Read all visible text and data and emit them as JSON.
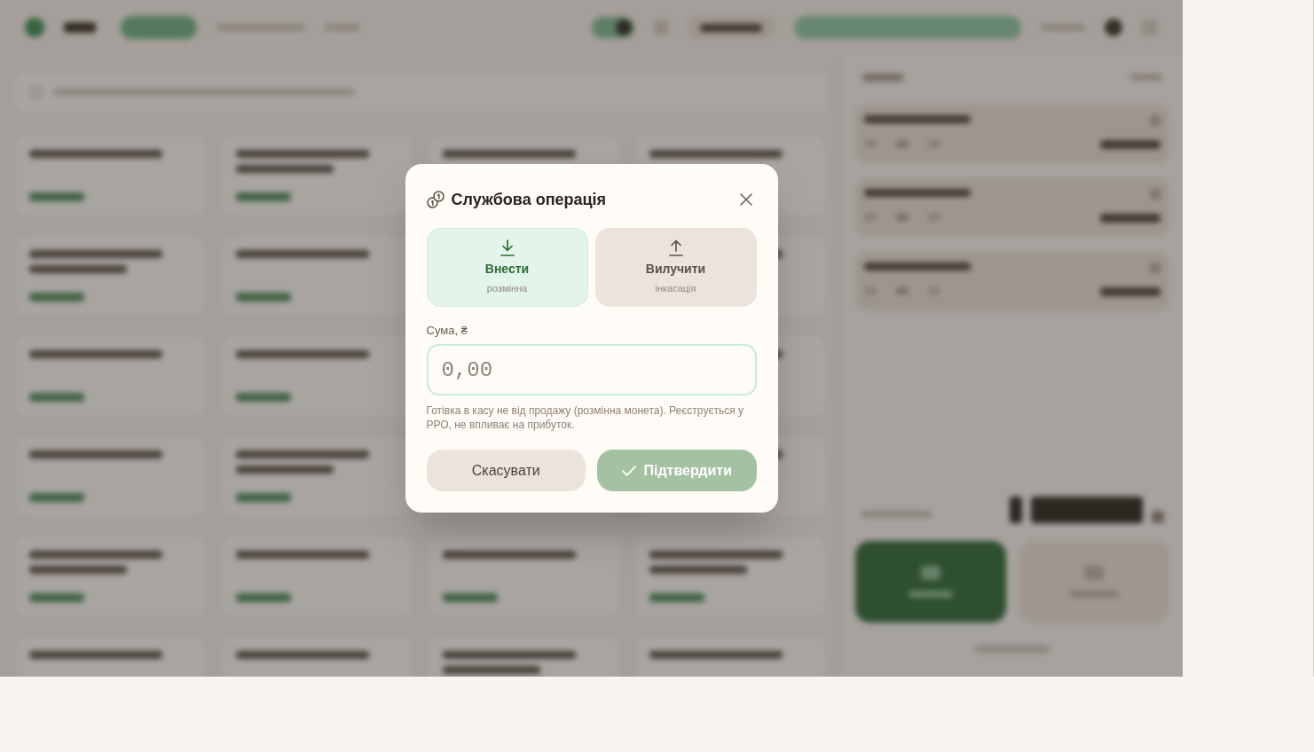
{
  "dialog": {
    "title": "Службова операція",
    "options": [
      {
        "kind": "deposit",
        "label": "Внести",
        "caption": "розмінна",
        "selected": true
      },
      {
        "kind": "withdraw",
        "label": "Вилучити",
        "caption": "інкасація",
        "selected": false
      }
    ],
    "amount_field": {
      "label": "Сума, ₴",
      "placeholder": "0,00"
    },
    "hint": "Готівка в касу не від продажу (розмінна монета). Реєструється у РРО, не впливає на прибуток.",
    "buttons": [
      {
        "kind": "cancel",
        "label": "Скасувати",
        "disabled": false
      },
      {
        "kind": "confirm",
        "label": "Підтвердити",
        "disabled": true
      }
    ]
  }
}
